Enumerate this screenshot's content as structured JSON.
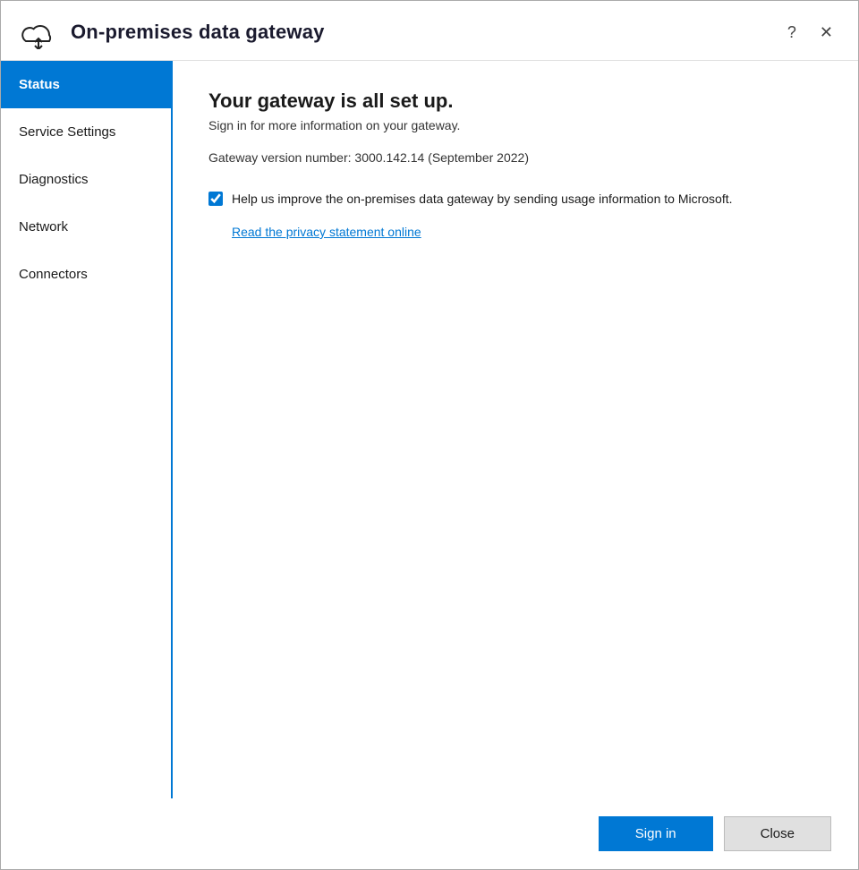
{
  "window": {
    "title": "On-premises data gateway"
  },
  "titlebar": {
    "help_label": "?",
    "close_label": "✕"
  },
  "sidebar": {
    "items": [
      {
        "id": "status",
        "label": "Status",
        "active": true
      },
      {
        "id": "service-settings",
        "label": "Service Settings",
        "active": false
      },
      {
        "id": "diagnostics",
        "label": "Diagnostics",
        "active": false
      },
      {
        "id": "network",
        "label": "Network",
        "active": false
      },
      {
        "id": "connectors",
        "label": "Connectors",
        "active": false
      }
    ]
  },
  "content": {
    "status_title": "Your gateway is all set up.",
    "status_subtitle": "Sign in for more information on your gateway.",
    "version_text": "Gateway version number: 3000.142.14 (September 2022)",
    "checkbox_label": "Help us improve the on-premises data gateway by sending usage information to Microsoft.",
    "privacy_link_label": "Read the privacy statement online",
    "checkbox_checked": true
  },
  "footer": {
    "signin_label": "Sign in",
    "close_label": "Close"
  }
}
